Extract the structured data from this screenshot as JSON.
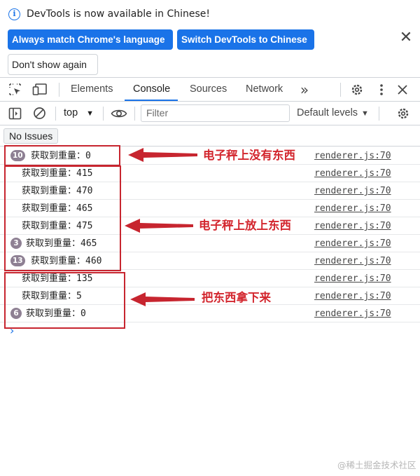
{
  "notification": {
    "message": "DevTools is now available in Chinese!",
    "match_button": "Always match Chrome's language",
    "switch_button": "Switch DevTools to Chinese",
    "dont_show_button": "Don't show again",
    "close_symbol": "✕"
  },
  "tabbar": {
    "tabs": [
      {
        "label": "Elements",
        "active": false
      },
      {
        "label": "Console",
        "active": true
      },
      {
        "label": "Sources",
        "active": false
      },
      {
        "label": "Network",
        "active": false
      }
    ],
    "more_tabs_symbol": "»"
  },
  "console_toolbar": {
    "context": "top",
    "filter_placeholder": "Filter",
    "levels": "Default levels"
  },
  "issues": {
    "label": "No Issues"
  },
  "messages": [
    {
      "count": "10",
      "text": "获取到重量：0",
      "source": "renderer.js:70"
    },
    {
      "count": "",
      "text": "获取到重量：415",
      "source": "renderer.js:70"
    },
    {
      "count": "",
      "text": "获取到重量：470",
      "source": "renderer.js:70"
    },
    {
      "count": "",
      "text": "获取到重量：465",
      "source": "renderer.js:70"
    },
    {
      "count": "",
      "text": "获取到重量：475",
      "source": "renderer.js:70"
    },
    {
      "count": "3",
      "text": "获取到重量：465",
      "source": "renderer.js:70"
    },
    {
      "count": "13",
      "text": "获取到重量：460",
      "source": "renderer.js:70"
    },
    {
      "count": "",
      "text": "获取到重量：135",
      "source": "renderer.js:70"
    },
    {
      "count": "",
      "text": "获取到重量：5",
      "source": "renderer.js:70"
    },
    {
      "count": "6",
      "text": "获取到重量：0",
      "source": "renderer.js:70"
    }
  ],
  "prompt_symbol": "›",
  "annotations": [
    {
      "label": "电子秤上没有东西"
    },
    {
      "label": "电子秤上放上东西"
    },
    {
      "label": "把东西拿下来"
    }
  ],
  "watermark": "@稀土掘金技术社区",
  "colors": {
    "accent": "#1a73e8",
    "annotation": "#c7252f",
    "badge": "#8e8093"
  }
}
